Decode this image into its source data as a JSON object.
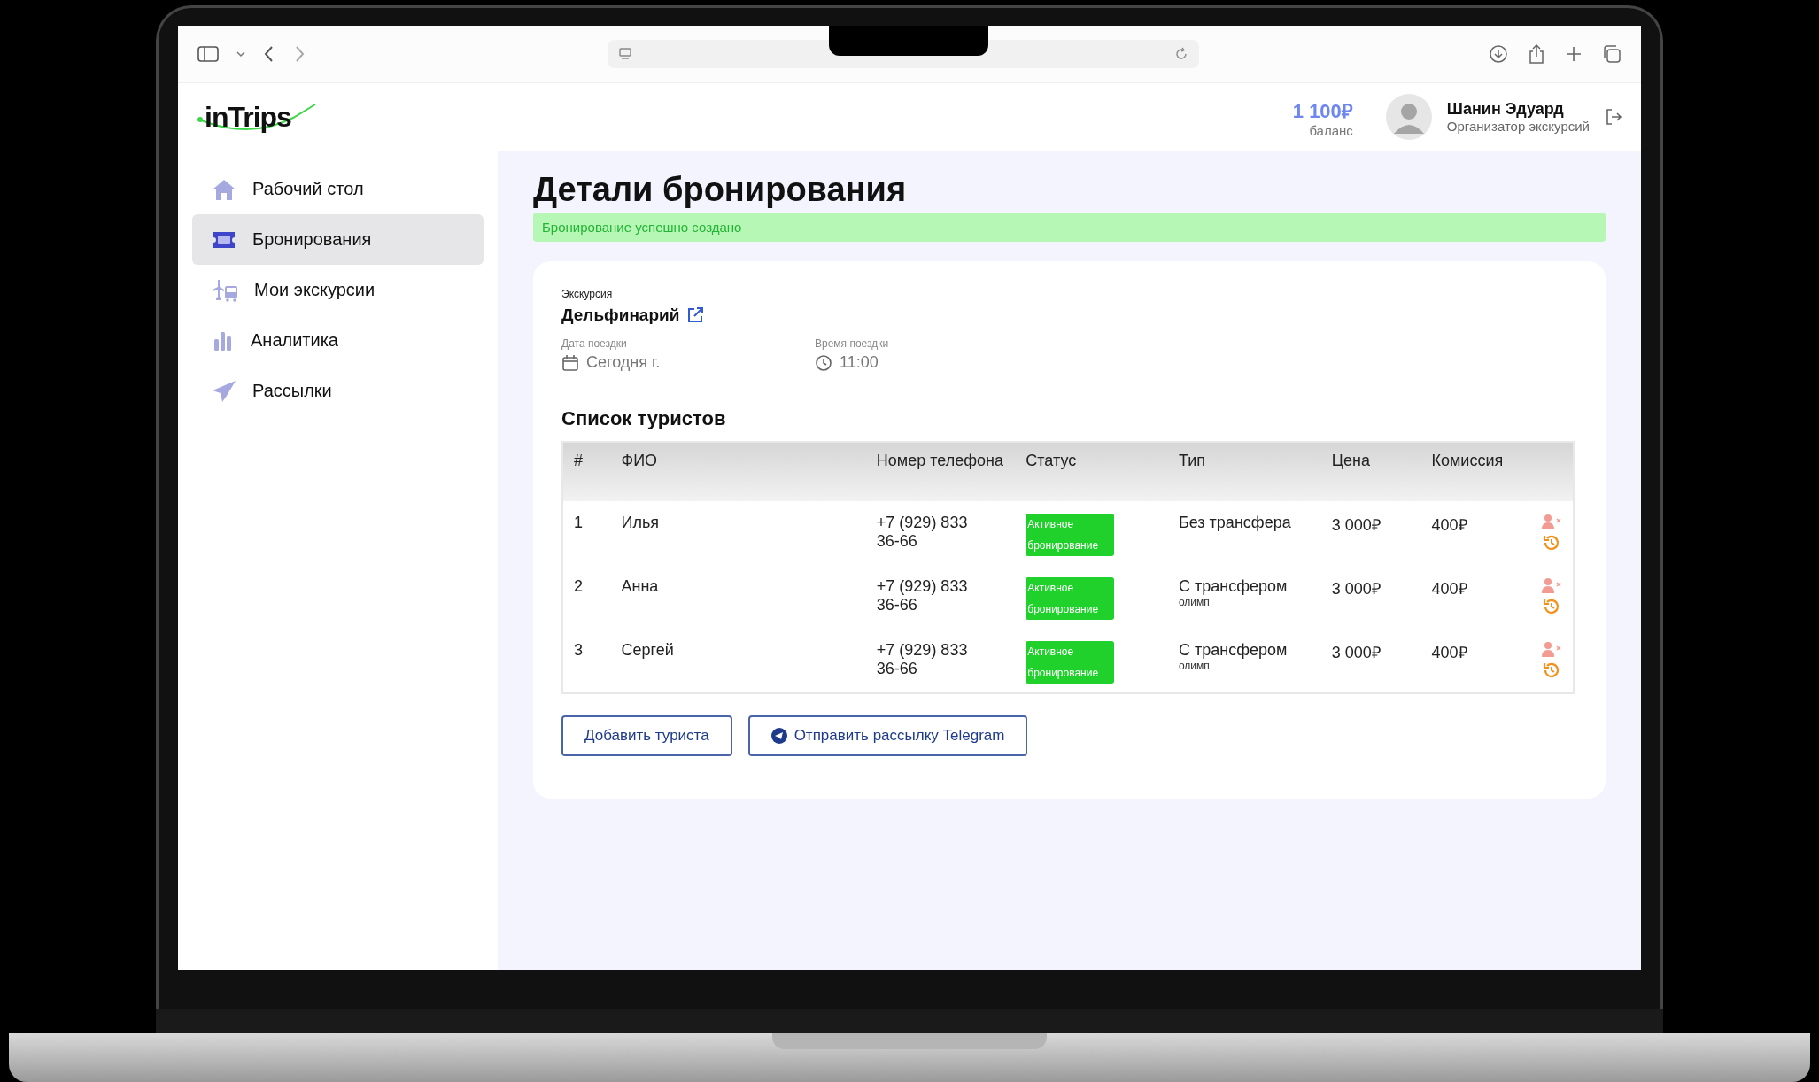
{
  "header": {
    "logo": "inTrips",
    "balance": "1 100₽",
    "balance_label": "баланс",
    "user_name": "Шанин Эдуард",
    "user_role": "Организатор экскурсий"
  },
  "sidebar": {
    "items": [
      {
        "label": "Рабочий стол",
        "selected": false
      },
      {
        "label": "Бронирования",
        "selected": true
      },
      {
        "label": "Мои экскурсии",
        "selected": false
      },
      {
        "label": "Аналитика",
        "selected": false
      },
      {
        "label": "Рассылки",
        "selected": false
      }
    ]
  },
  "page": {
    "title": "Детали бронирования",
    "alert": "Бронирование успешно создано"
  },
  "details": {
    "excursion_label": "Экскурсия",
    "excursion": "Дельфинарий",
    "date_label": "Дата поездки",
    "date": "Сегодня г.",
    "time_label": "Время поездки",
    "time": "11:00"
  },
  "tourists": {
    "title": "Список туристов",
    "columns": [
      "#",
      "ФИО",
      "Номер телефона",
      "Статус",
      "Тип",
      "Цена",
      "Комиссия"
    ],
    "rows": [
      {
        "num": "1",
        "name": "Илья",
        "phone": "+7 (929) 833 36-66",
        "status": "Активное бронирование",
        "type": "Без трансфера",
        "price": "3 000₽",
        "commission": "400₽"
      },
      {
        "num": "2",
        "name": "Анна",
        "phone": "+7 (929) 833 36-66",
        "status": "Активное бронирование",
        "type": "С трансфером",
        "type_note": "олимп",
        "price": "3 000₽",
        "commission": "400₽"
      },
      {
        "num": "3",
        "name": "Сергей",
        "phone": "+7 (929) 833 36-66",
        "status": "Активное бронирование",
        "type": "С трансфером",
        "type_note": "олимп",
        "price": "3 000₽",
        "commission": "400₽"
      }
    ]
  },
  "buttons": [
    {
      "label": "Добавить туриста"
    },
    {
      "label": "Отправить рассылку Telegram"
    }
  ]
}
